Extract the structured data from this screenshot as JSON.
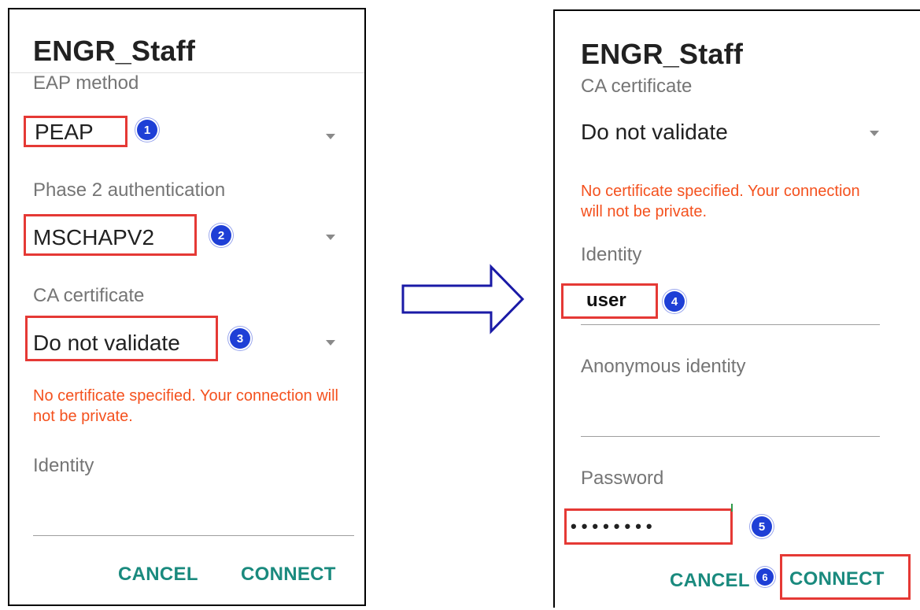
{
  "left_dialog": {
    "title": "ENGR_Staff",
    "eap_method_label": "EAP method",
    "eap_method_value": "PEAP",
    "phase2_label": "Phase 2 authentication",
    "phase2_value": "MSCHAPV2",
    "ca_cert_label": "CA certificate",
    "ca_cert_value": "Do not validate",
    "warning": "No certificate specified. Your connection will not be private.",
    "identity_label": "Identity",
    "cancel": "CANCEL",
    "connect": "CONNECT",
    "badges": [
      "1",
      "2",
      "3"
    ]
  },
  "right_dialog": {
    "title": "ENGR_Staff",
    "ca_cert_label": "CA certificate",
    "ca_cert_value": "Do not validate",
    "warning": "No certificate specified. Your connection will not be private.",
    "identity_label": "Identity",
    "identity_value": "user",
    "anon_label": "Anonymous identity",
    "password_label": "Password",
    "password_value": "••••••••",
    "cancel": "CANCEL",
    "connect": "CONNECT",
    "badges": [
      "4",
      "5",
      "6"
    ]
  },
  "colors": {
    "highlight": "#e53935",
    "badge": "#1e3fd6",
    "warning": "#f4511e",
    "button": "#1a8a7e",
    "arrow": "#1a1aa6"
  },
  "icons": [
    "dropdown-caret-icon",
    "right-arrow-icon"
  ]
}
